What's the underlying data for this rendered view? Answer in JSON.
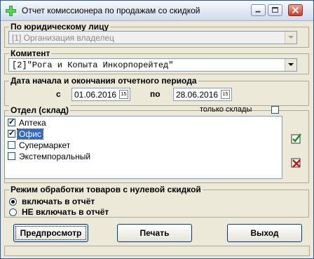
{
  "window": {
    "title": "Отчет комиссионера по продажам со скидкой",
    "icon": "green-plus-icon",
    "controls": [
      "minimize-icon",
      "maximize-icon",
      "close-icon"
    ]
  },
  "legal_entity": {
    "title": "По юридическому лицу",
    "value": "[1] Организация владелец",
    "enabled": false
  },
  "consignor": {
    "title": "Комитент",
    "value": "[2]\"Рога и Копыта Инкорпорейтед\""
  },
  "period": {
    "title": "Дата начала и окончания отчетного периода",
    "from_label": "с",
    "from_value": "01.06.2016",
    "to_label": "по",
    "to_value": "28.06.2016",
    "calendar_glyph": "15"
  },
  "department": {
    "title": "Отдел (склад)",
    "only_warehouses_label": "только склады",
    "only_warehouses_checked": false,
    "items": [
      {
        "label": "Аптека",
        "checked": true,
        "selected": false
      },
      {
        "label": "Офис",
        "checked": true,
        "selected": true
      },
      {
        "label": "Супермаркет",
        "checked": false,
        "selected": false
      },
      {
        "label": "Экстемпоральный",
        "checked": false,
        "selected": false
      }
    ],
    "side_icons": [
      "check-all-icon",
      "uncheck-all-icon"
    ]
  },
  "zero_discount_mode": {
    "title": "Режим обработки товаров с нулевой скидкой",
    "options": [
      {
        "label": "включать в отчёт",
        "selected": true
      },
      {
        "label": "НЕ включать в отчёт",
        "selected": false
      }
    ]
  },
  "buttons": {
    "preview": "Предпросмотр",
    "print": "Печать",
    "exit": "Выход"
  },
  "colors": {
    "window_bg": "#ece9d8",
    "selection": "#316ac5",
    "frame": "#2b5a9e"
  }
}
